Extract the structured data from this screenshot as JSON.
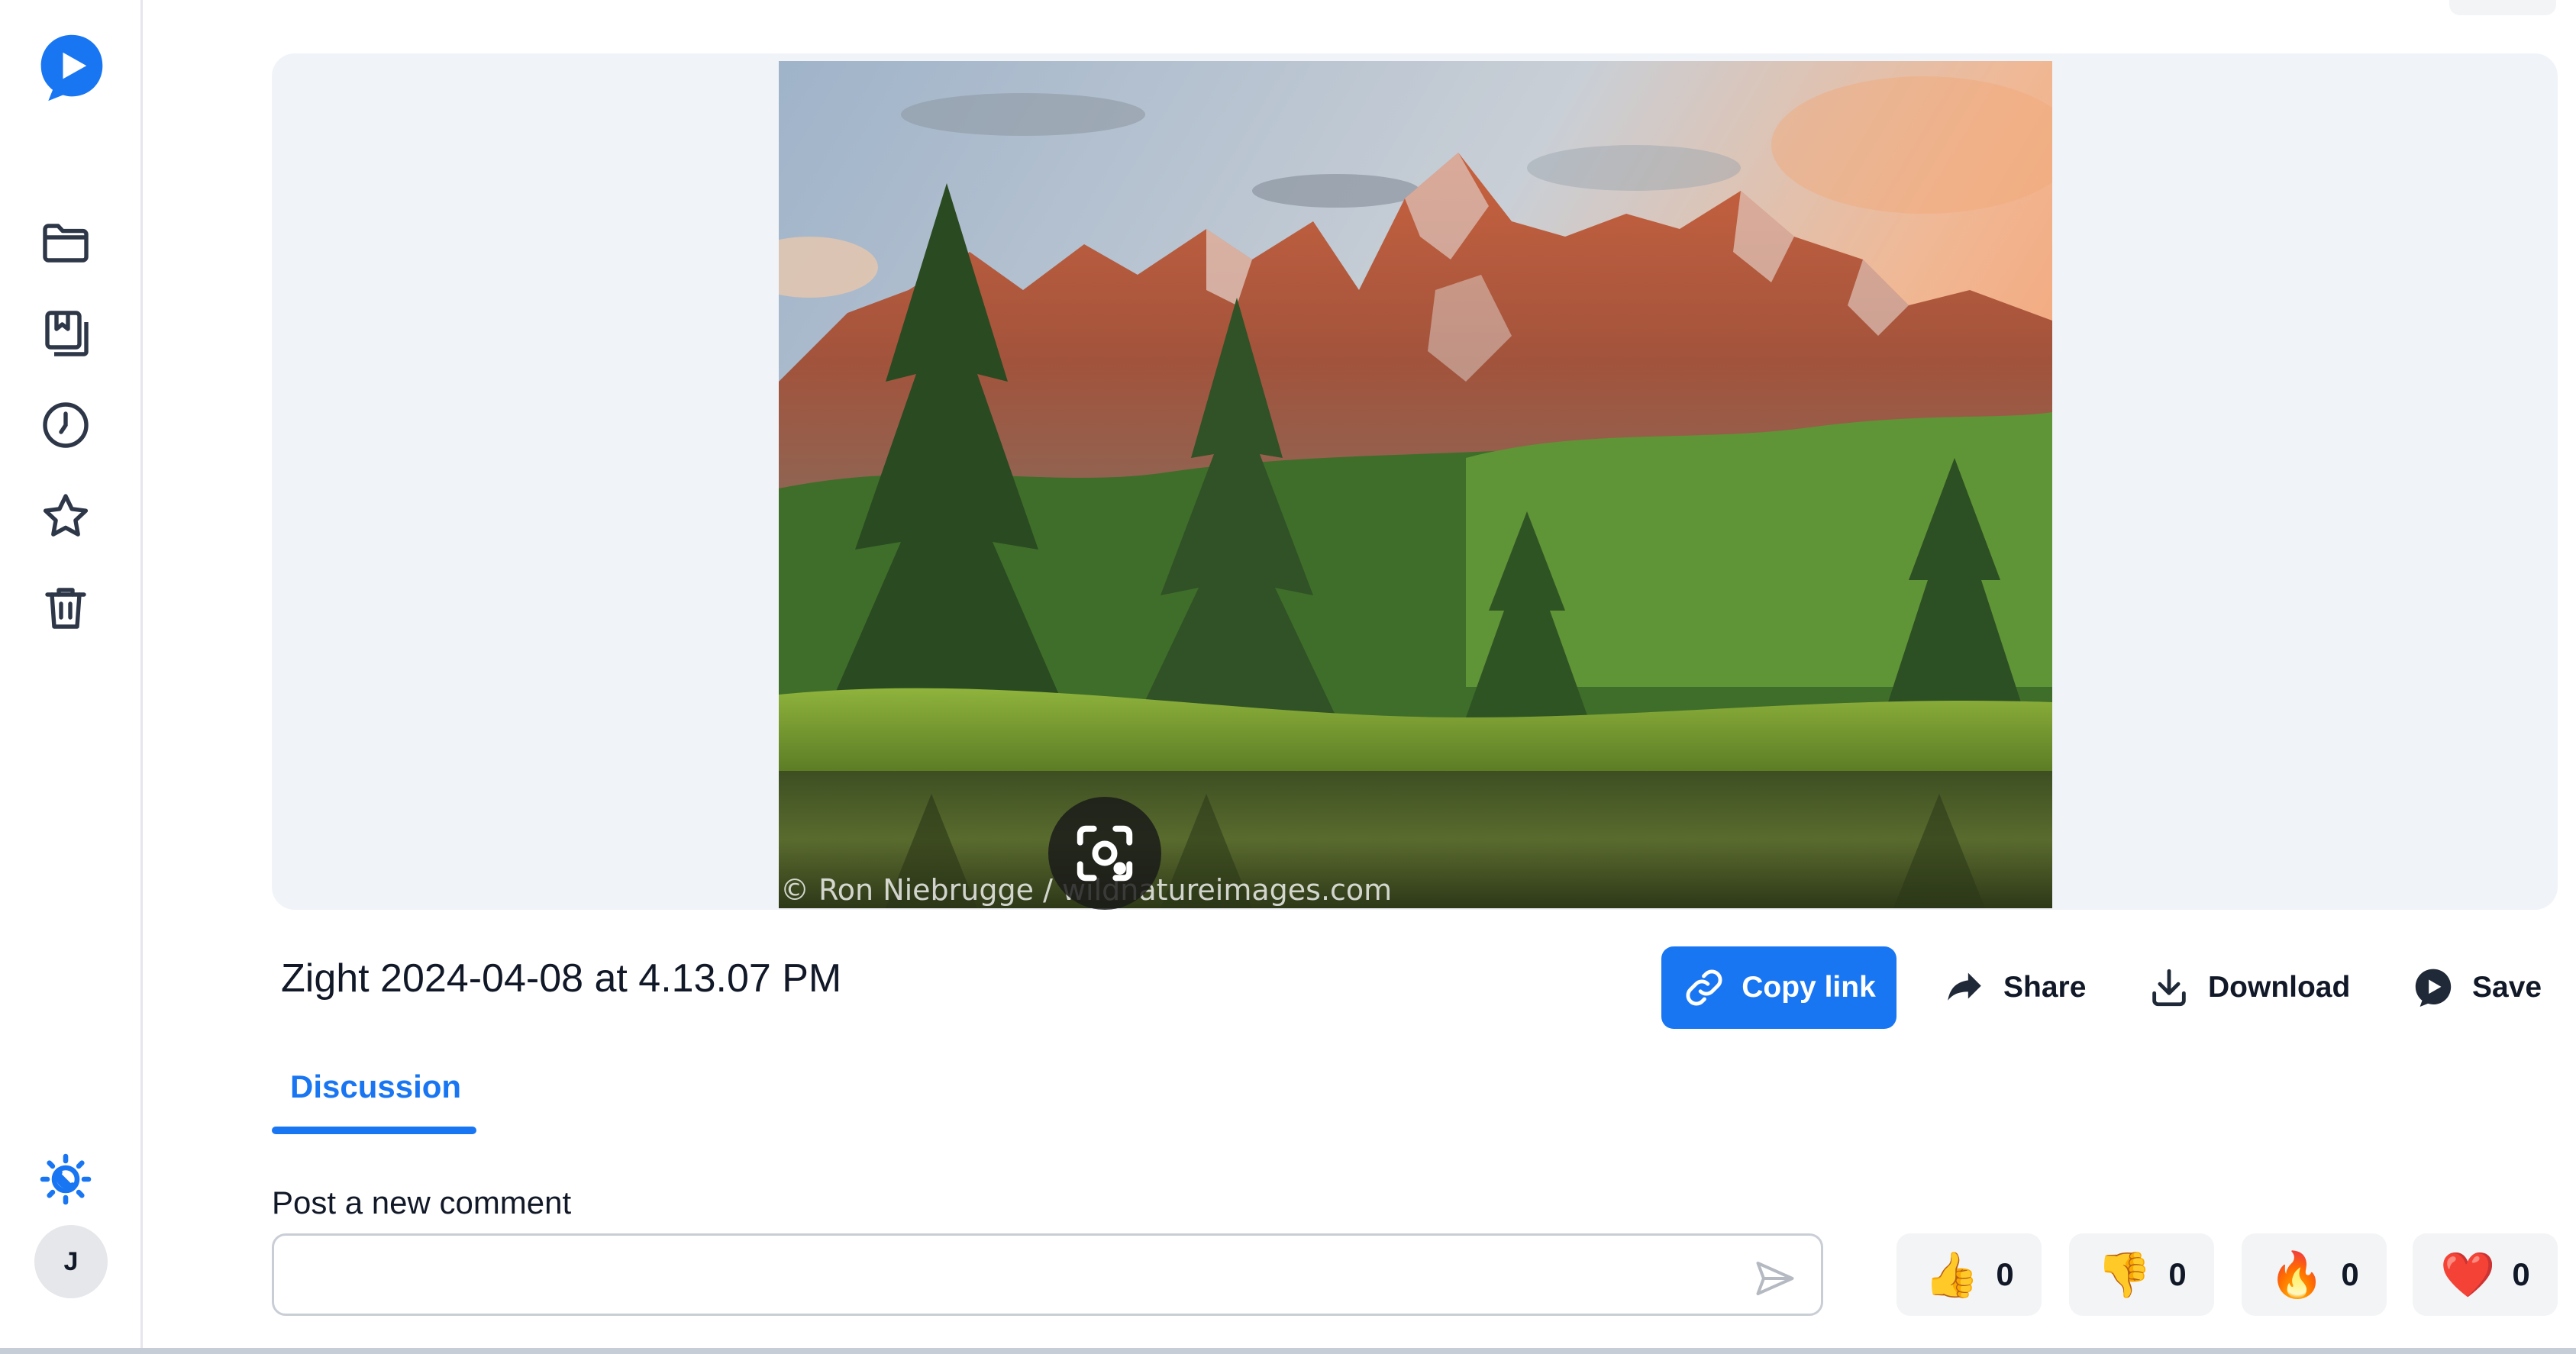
{
  "sidebar": {
    "items": [
      {
        "name": "folder-icon",
        "label": "Library"
      },
      {
        "name": "collections-icon",
        "label": "Collections"
      },
      {
        "name": "clock-icon",
        "label": "Recent"
      },
      {
        "name": "star-icon",
        "label": "Favorites"
      },
      {
        "name": "trash-icon",
        "label": "Trash"
      }
    ],
    "theme_toggle_icon": "sun-moon-icon",
    "avatar_initial": "J"
  },
  "viewer": {
    "photo_credit": "© Ron Niebrugge / wildnatureimages.com",
    "lens_icon": "lens-search-icon"
  },
  "file": {
    "title": "Zight 2024-04-08 at 4.13.07 PM"
  },
  "actions": {
    "copy_link": "Copy link",
    "share": "Share",
    "download": "Download",
    "save": "Save"
  },
  "tabs": {
    "discussion": "Discussion"
  },
  "comment": {
    "label": "Post a new comment",
    "value": "",
    "placeholder": ""
  },
  "reactions": [
    {
      "emoji": "👍",
      "name": "thumbs-up",
      "count": "0"
    },
    {
      "emoji": "👎",
      "name": "thumbs-down",
      "count": "0"
    },
    {
      "emoji": "🔥",
      "name": "fire",
      "count": "0"
    },
    {
      "emoji": "❤️",
      "name": "heart",
      "count": "0"
    }
  ],
  "colors": {
    "accent": "#1976f3",
    "viewer_bg": "#f0f3f8"
  }
}
